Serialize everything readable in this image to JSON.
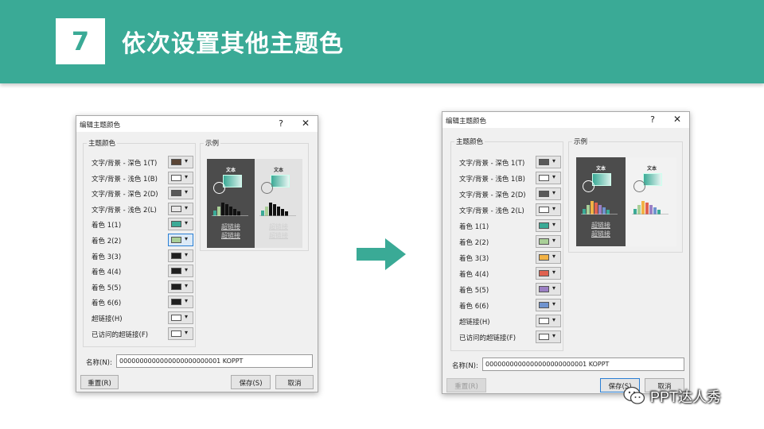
{
  "slide": {
    "step_number": "7",
    "title": "依次设置其他主题色"
  },
  "dialogs": [
    {
      "title": "编辑主题颜色",
      "help": "?",
      "close": "✕",
      "colors_group_label": "主题颜色",
      "sample_group_label": "示例",
      "rows": [
        {
          "label": "文字/背景 - 深色 1(T)",
          "color": "#5a4434"
        },
        {
          "label": "文字/背景 - 浅色 1(B)",
          "color": "#ffffff"
        },
        {
          "label": "文字/背景 - 深色 2(D)",
          "color": "#595959"
        },
        {
          "label": "文字/背景 - 浅色 2(L)",
          "color": "#e7e6e6"
        },
        {
          "label": "着色 1(1)",
          "color": "#3aaa96"
        },
        {
          "label": "着色 2(2)",
          "color": "#a9cf97"
        },
        {
          "label": "着色 3(3)",
          "color": "#1f1f1f"
        },
        {
          "label": "着色 4(4)",
          "color": "#1f1f1f"
        },
        {
          "label": "着色 5(5)",
          "color": "#1f1f1f"
        },
        {
          "label": "着色 6(6)",
          "color": "#1f1f1f"
        },
        {
          "label": "超链接(H)",
          "color": "#ffffff"
        },
        {
          "label": "已访问的超链接(F)",
          "color": "#ffffff"
        }
      ],
      "sample_text": "文本",
      "hyperlink_text": "超链接",
      "name_label": "名称(N):",
      "name_value": "0000000000000000000000001 KOPPT",
      "reset_label": "重置(R)",
      "save_label": "保存(S)",
      "cancel_label": "取消"
    },
    {
      "title": "编辑主题颜色",
      "help": "?",
      "close": "✕",
      "colors_group_label": "主题颜色",
      "sample_group_label": "示例",
      "rows": [
        {
          "label": "文字/背景 - 深色 1(T)",
          "color": "#595959"
        },
        {
          "label": "文字/背景 - 浅色 1(B)",
          "color": "#ffffff"
        },
        {
          "label": "文字/背景 - 深色 2(D)",
          "color": "#595959"
        },
        {
          "label": "文字/背景 - 浅色 2(L)",
          "color": "#ffffff"
        },
        {
          "label": "着色 1(1)",
          "color": "#3aaa96"
        },
        {
          "label": "着色 2(2)",
          "color": "#a9cf97"
        },
        {
          "label": "着色 3(3)",
          "color": "#f2b244"
        },
        {
          "label": "着色 4(4)",
          "color": "#e0614f"
        },
        {
          "label": "着色 5(5)",
          "color": "#9b7fc4"
        },
        {
          "label": "着色 6(6)",
          "color": "#6f93cf"
        },
        {
          "label": "超链接(H)",
          "color": "#ffffff"
        },
        {
          "label": "已访问的超链接(F)",
          "color": "#ffffff"
        }
      ],
      "sample_text": "文本",
      "hyperlink_text": "超链接",
      "name_label": "名称(N):",
      "name_value": "0000000000000000000000001 KOPPT",
      "reset_label": "重置(R)",
      "save_label": "保存(S)",
      "cancel_label": "取消"
    }
  ],
  "arrow_color": "#3aaa96",
  "watermark": {
    "text": "PPT达人秀"
  }
}
